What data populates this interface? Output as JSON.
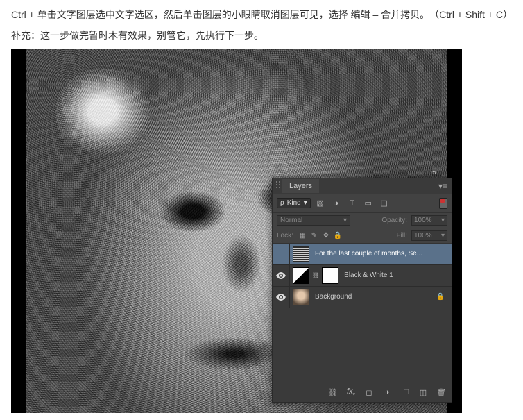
{
  "instructions": {
    "line1": "Ctrl + 单击文字图层选中文字选区，然后单击图层的小眼睛取消图层可见，选择 编辑 – 合并拷贝。　（Ctrl + Shift + C）",
    "line2": "补充：这一步做完暂时木有效果，别管它，先执行下一步。"
  },
  "panel": {
    "title": "Layers",
    "filter": {
      "kind_prefix": "ρ",
      "kind_label": "Kind",
      "icons": [
        "image",
        "adjust",
        "text",
        "shape",
        "smart"
      ]
    },
    "blend": {
      "mode": "Normal",
      "opacity_label": "Opacity:",
      "opacity_value": "100%"
    },
    "lock": {
      "label": "Lock:",
      "fill_label": "Fill:",
      "fill_value": "100%"
    },
    "layers": [
      {
        "visible": false,
        "name": "For the last couple of months, Se...",
        "type": "text",
        "selected": true,
        "locked": false
      },
      {
        "visible": true,
        "name": "Black & White 1",
        "type": "adjustment",
        "selected": false,
        "locked": false
      },
      {
        "visible": true,
        "name": "Background",
        "type": "image",
        "selected": false,
        "locked": true
      }
    ],
    "footer_icons": [
      "link",
      "fx",
      "mask",
      "adjust",
      "group",
      "new",
      "trash"
    ]
  }
}
